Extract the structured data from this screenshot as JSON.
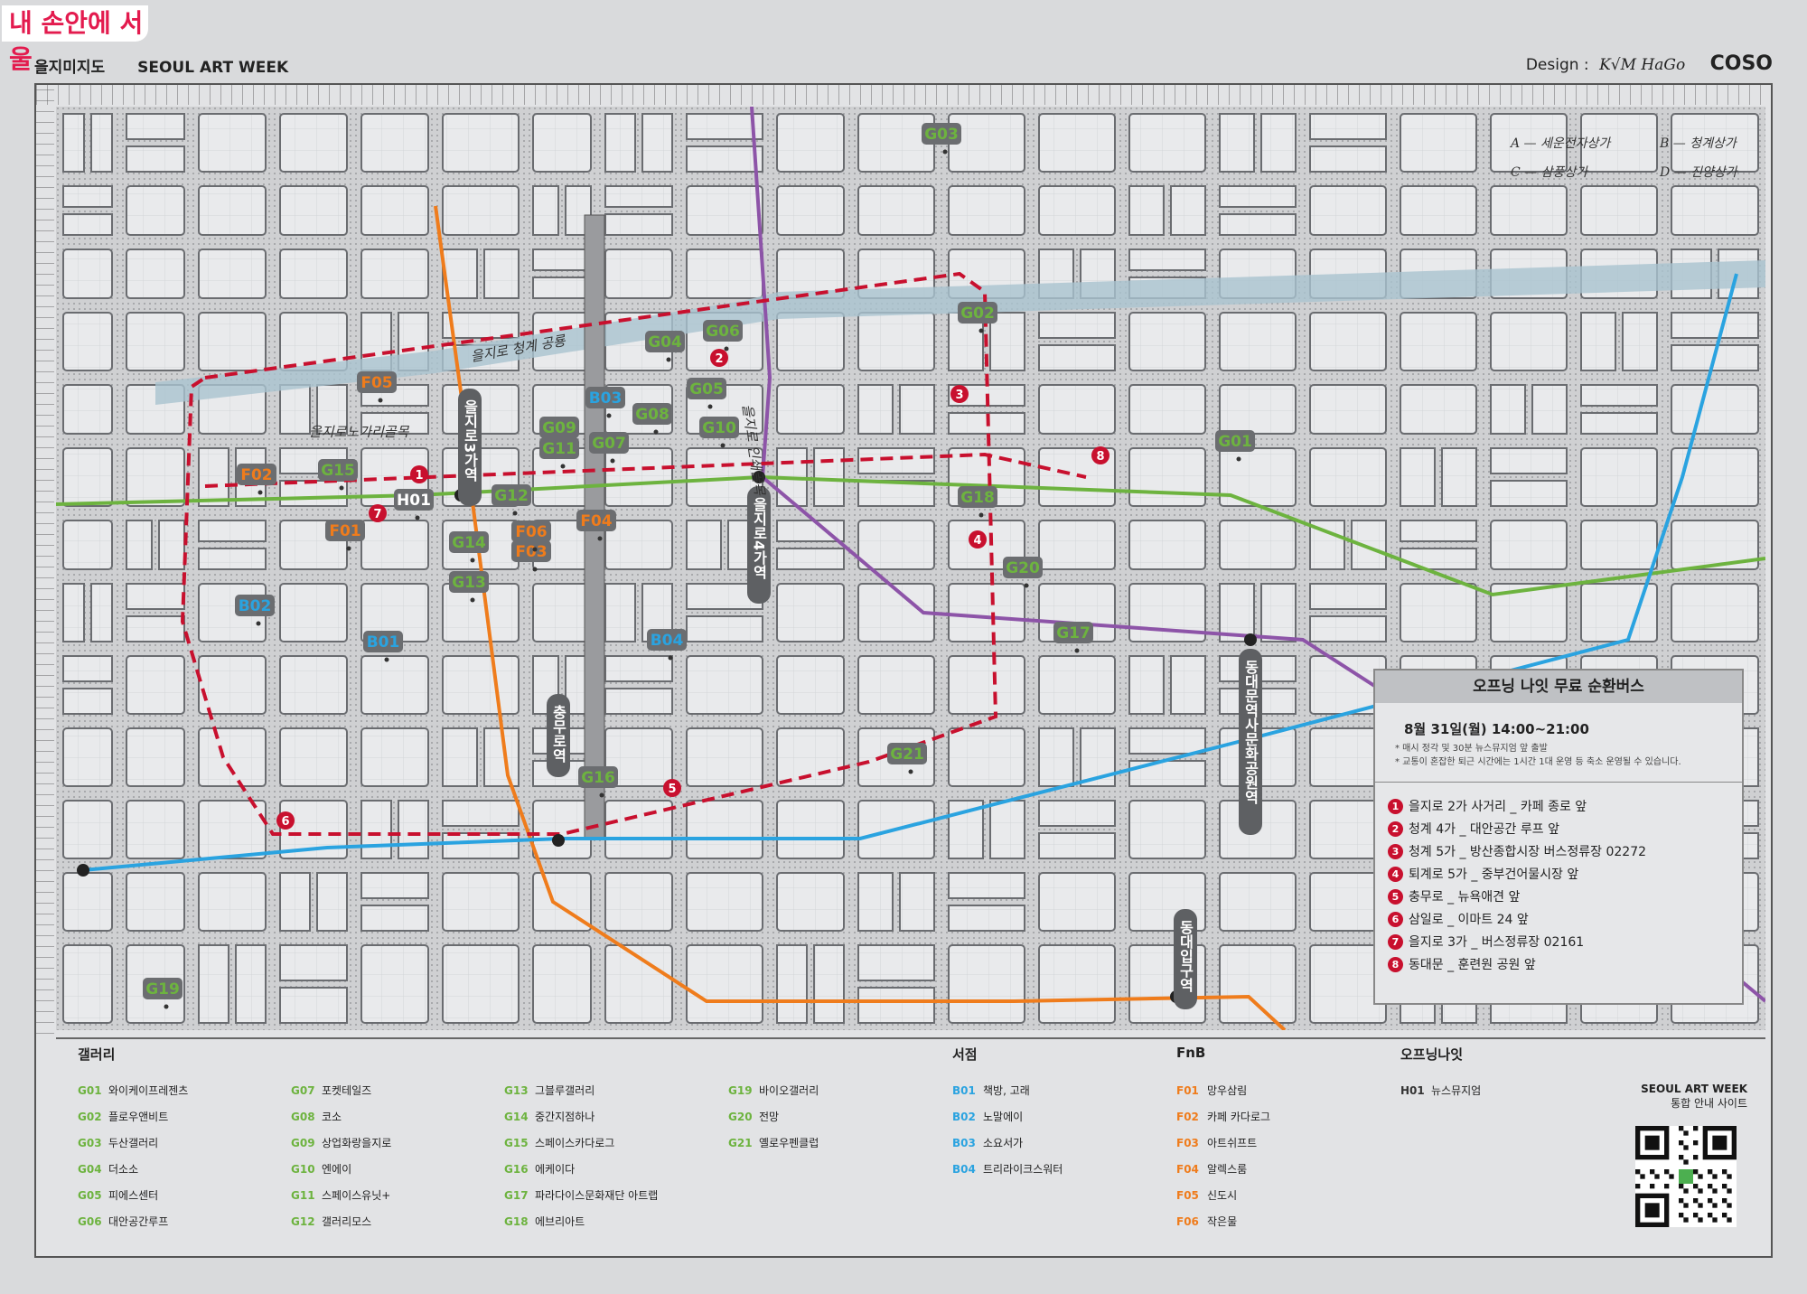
{
  "corner_logo": "내 손안에 서울",
  "header": {
    "left_title_ko": "을지미지도",
    "left_title_en": "SEOUL ART WEEK",
    "design_label": "Design :",
    "designer_signature": "K√M HaGo",
    "brand": "COSO"
  },
  "map": {
    "arcade_legend": [
      {
        "letter": "A",
        "name": "세운전자상가"
      },
      {
        "letter": "B",
        "name": "청계상가"
      },
      {
        "letter": "C",
        "name": "삼풍상가"
      },
      {
        "letter": "D",
        "name": "진양상가"
      }
    ],
    "station_labels": {
      "euljiro3ga": "을지로3가역",
      "euljiro4ga": "을지로4가역",
      "ddp": "동대문역사문화공원역",
      "chungmuro": "충무로역",
      "dongguk": "동대입구역"
    },
    "street_notes": [
      "을지로 청계 공룡",
      "을지로노가리골목",
      "을지로 인쇄골목"
    ],
    "line_colors": {
      "line2": "#6db33f",
      "line3": "#ef7c1c",
      "line4": "#2aa3e0",
      "line5": "#8d54a8",
      "bus": "#c8102e"
    },
    "code_colors": {
      "G": "#6db33f",
      "B": "#2aa3e0",
      "F": "#ef7c1c",
      "H": "#ffffff"
    },
    "markers": [
      "G01",
      "G02",
      "G03",
      "G04",
      "G05",
      "G06",
      "G07",
      "G08",
      "G09",
      "G10",
      "G11",
      "G12",
      "G13",
      "G14",
      "G15",
      "G16",
      "G17",
      "G18",
      "G19",
      "G20",
      "G21",
      "B01",
      "B02",
      "B03",
      "B04",
      "F01",
      "F02",
      "F03",
      "F04",
      "F05",
      "F06",
      "H01"
    ],
    "stop_numbers": [
      "1",
      "2",
      "3",
      "4",
      "5",
      "6",
      "7",
      "8"
    ]
  },
  "infobox": {
    "title": "오프닝 나잇 무료 순환버스",
    "time": "8월 31일(월) 14:00~21:00",
    "note1": "* 매시 정각 및 30분 뉴스뮤지엄 앞 출발",
    "note2": "* 교통이 혼잡한 퇴근 시간에는 1시간 1대 운영 등 축소 운영될 수 있습니다.",
    "stops": [
      {
        "n": "1",
        "text": "을지로 2가 사거리 _ 카페 종로 앞"
      },
      {
        "n": "2",
        "text": "청계 4가 _ 대안공간 루프 앞"
      },
      {
        "n": "3",
        "text": "청계 5가 _ 방산종합시장 버스정류장 02272"
      },
      {
        "n": "4",
        "text": "퇴계로 5가 _ 중부건어물시장 앞"
      },
      {
        "n": "5",
        "text": "충무로 _ 뉴욕애견 앞"
      },
      {
        "n": "6",
        "text": "삼일로 _ 이마트 24 앞"
      },
      {
        "n": "7",
        "text": "을지로 3가 _ 버스정류장 02161"
      },
      {
        "n": "8",
        "text": "동대문 _ 훈련원 공원 앞"
      }
    ]
  },
  "legend": {
    "gallery_label": "갤러리",
    "bookstore_label": "서점",
    "fnb_label": "FnB",
    "opening_label": "오프닝나잇",
    "gallery_col1": [
      {
        "code": "G01",
        "name": "와이케이프레젠츠"
      },
      {
        "code": "G02",
        "name": "플로우앤비트"
      },
      {
        "code": "G03",
        "name": "두산갤러리"
      },
      {
        "code": "G04",
        "name": "더소소"
      },
      {
        "code": "G05",
        "name": "피에스센터"
      },
      {
        "code": "G06",
        "name": "대안공간루프"
      }
    ],
    "gallery_col2": [
      {
        "code": "G07",
        "name": "포켓테일즈"
      },
      {
        "code": "G08",
        "name": "코소"
      },
      {
        "code": "G09",
        "name": "상업화랑을지로"
      },
      {
        "code": "G10",
        "name": "엔에이"
      },
      {
        "code": "G11",
        "name": "스페이스유닛+"
      },
      {
        "code": "G12",
        "name": "갤러리모스"
      }
    ],
    "gallery_col3": [
      {
        "code": "G13",
        "name": "그블루갤러리"
      },
      {
        "code": "G14",
        "name": "중간지점하나"
      },
      {
        "code": "G15",
        "name": "스페이스카다로그"
      },
      {
        "code": "G16",
        "name": "에케이다"
      },
      {
        "code": "G17",
        "name": "파라다이스문화재단 아트랩"
      },
      {
        "code": "G18",
        "name": "에브리아트"
      }
    ],
    "gallery_col4": [
      {
        "code": "G19",
        "name": "바이오갤러리"
      },
      {
        "code": "G20",
        "name": "전망"
      },
      {
        "code": "G21",
        "name": "옐로우펜클럽"
      }
    ],
    "bookstores": [
      {
        "code": "B01",
        "name": "책방, 고래"
      },
      {
        "code": "B02",
        "name": "노말에이"
      },
      {
        "code": "B03",
        "name": "소요서가"
      },
      {
        "code": "B04",
        "name": "트리라이크스워터"
      }
    ],
    "fnb": [
      {
        "code": "F01",
        "name": "망우삼림"
      },
      {
        "code": "F02",
        "name": "카페 카다로그"
      },
      {
        "code": "F03",
        "name": "아트쉬프트"
      },
      {
        "code": "F04",
        "name": "알렉스룸"
      },
      {
        "code": "F05",
        "name": "신도시"
      },
      {
        "code": "F06",
        "name": "작은물"
      }
    ],
    "opening": [
      {
        "code": "H01",
        "name": "뉴스뮤지엄"
      }
    ],
    "site_title": "SEOUL ART WEEK",
    "site_sub": "통합 안내 사이트"
  }
}
